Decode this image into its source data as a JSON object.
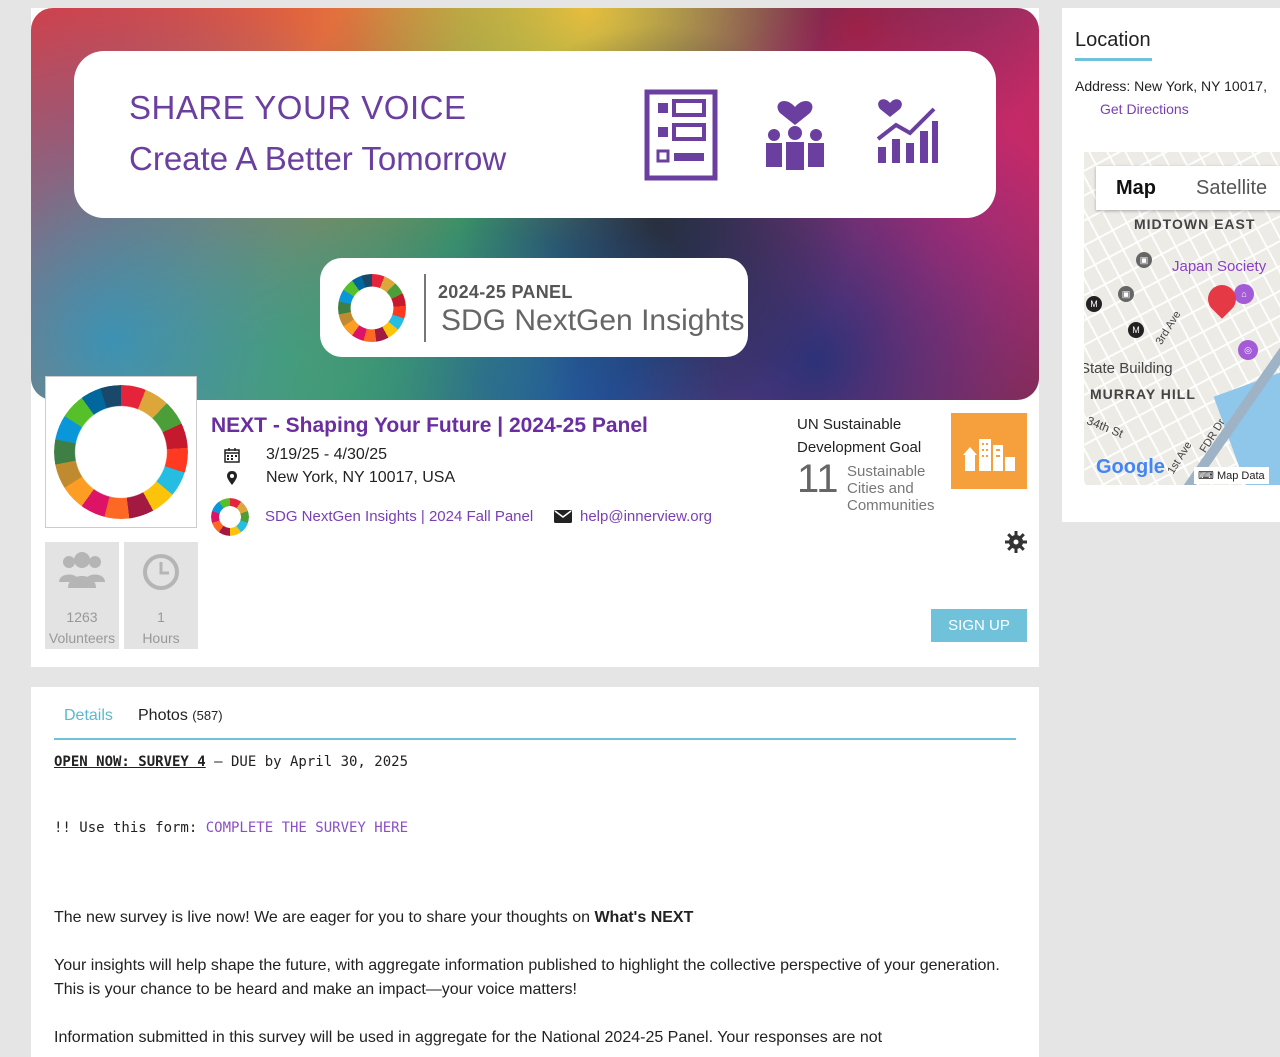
{
  "banner": {
    "line1": "SHARE YOUR VOICE",
    "line2": "Create A Better Tomorrow",
    "panel_year": "2024-25 PANEL",
    "panel_name": "SDG NextGen Insights"
  },
  "event": {
    "title": "NEXT - Shaping Your Future | 2024-25 Panel",
    "dates": "3/19/25 - 4/30/25",
    "location": "New York, NY 10017, USA",
    "org_link": "SDG NextGen Insights | 2024 Fall Panel",
    "email": "help@innerview.org",
    "signup_label": "SIGN UP"
  },
  "stats": {
    "volunteers_count": "1263",
    "volunteers_label": "Volunteers",
    "hours_count": "1",
    "hours_label": "Hours"
  },
  "sdg": {
    "heading": "UN Sustainable Development Goal",
    "number": "11",
    "name": "Sustainable Cities and Communities",
    "tile_color": "#f59f3d"
  },
  "tabs": {
    "details": "Details",
    "photos": "Photos",
    "photos_count": "(587)"
  },
  "details": {
    "open_now": "OPEN NOW: SURVEY 4",
    "due": " – DUE by April 30, 2025",
    "use_form_prefix": "!! Use this form: ",
    "use_form_link": "COMPLETE THE SURVEY HERE",
    "p1_text": "The new survey is live now! We are eager for you to share your thoughts on ",
    "p1_bold": "What's NEXT",
    "p2": "Your insights will help shape the future, with aggregate information published to highlight the collective perspective of your generation. This is your chance to be heard and make an impact—your voice matters!",
    "p3": "Information submitted in this survey will be used in aggregate for the National 2024-25 Panel.  Your responses are not"
  },
  "location": {
    "title": "Location",
    "address": "Address: New York, NY 10017,",
    "directions": "Get Directions",
    "map_tab": "Map",
    "satellite_tab": "Satellite",
    "labels": {
      "midtown": "MIDTOWN EAST",
      "japan": "Japan Society",
      "state": "State Building",
      "murray": "MURRAY HILL",
      "third": "3rd Ave",
      "first": "1st Ave",
      "fdr": "FDR Dr",
      "street": "34th St"
    },
    "google": "Google",
    "map_data": "Map Data"
  }
}
